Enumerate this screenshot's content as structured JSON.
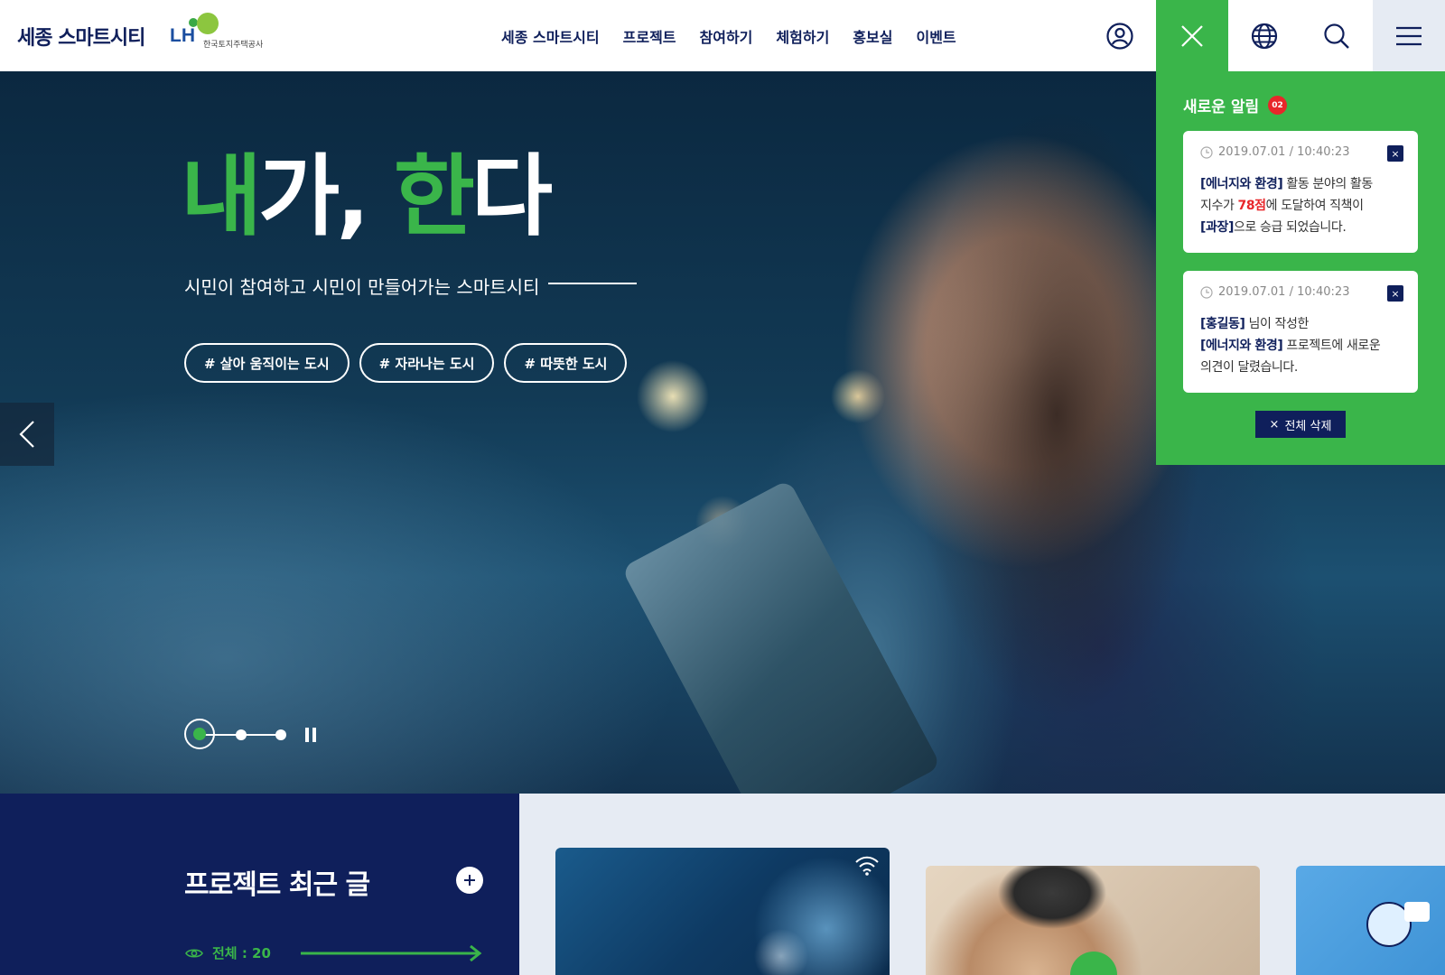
{
  "header": {
    "logo_text": "세종 스마트시티",
    "lh_text": "LH",
    "lh_subtitle": "한국토지주택공사",
    "nav": [
      "세종 스마트시티",
      "프로젝트",
      "참여하기",
      "체험하기",
      "홍보실",
      "이벤트"
    ],
    "icons": [
      "user-icon",
      "close-icon",
      "globe-icon",
      "search-icon",
      "menu-icon"
    ]
  },
  "hero": {
    "title_parts": [
      {
        "text": "내",
        "color": "#3ab54a"
      },
      {
        "text": "가, ",
        "color": "#ffffff"
      },
      {
        "text": "한",
        "color": "#3ab54a"
      },
      {
        "text": "다",
        "color": "#ffffff"
      }
    ],
    "subtitle": "시민이 참여하고 시민이 만들어가는 스마트시티",
    "tags": [
      "# 살아 움직이는 도시",
      "# 자라나는 도시",
      "# 따뜻한 도시"
    ],
    "slide_count": 3,
    "active_slide": 1
  },
  "notice": {
    "title": "새로운 알림",
    "count": "02",
    "cards": [
      {
        "time": "2019.07.01 / 10:40:23",
        "line1_prefix": "[에너지와 환경]",
        "line1_rest": " 활동 분야의  활동",
        "line2_prefix": "지수가 ",
        "line2_highlight": "78점",
        "line2_rest": "에 도달하여 직책이",
        "line3_prefix": "[과장]",
        "line3_rest": "으로 승급 되었습니다."
      },
      {
        "time": "2019.07.01 / 10:40:23",
        "line1_prefix": "[홍길동]",
        "line1_rest": " 님이 작성한",
        "line2_prefix": "[에너지와 환경]",
        "line2_rest": " 프로젝트에 새로운",
        "line3_text": "의견이 달렸습니다."
      }
    ],
    "clear_all_label": "전체 삭제",
    "close_glyph": "×"
  },
  "recent": {
    "title": "프로젝트 최근 글",
    "count_label": "전체 : 20"
  },
  "colors": {
    "navy": "#0f1f5b",
    "green": "#3ab54a",
    "light_bg": "#e6ebf3",
    "red": "#e8262a"
  }
}
